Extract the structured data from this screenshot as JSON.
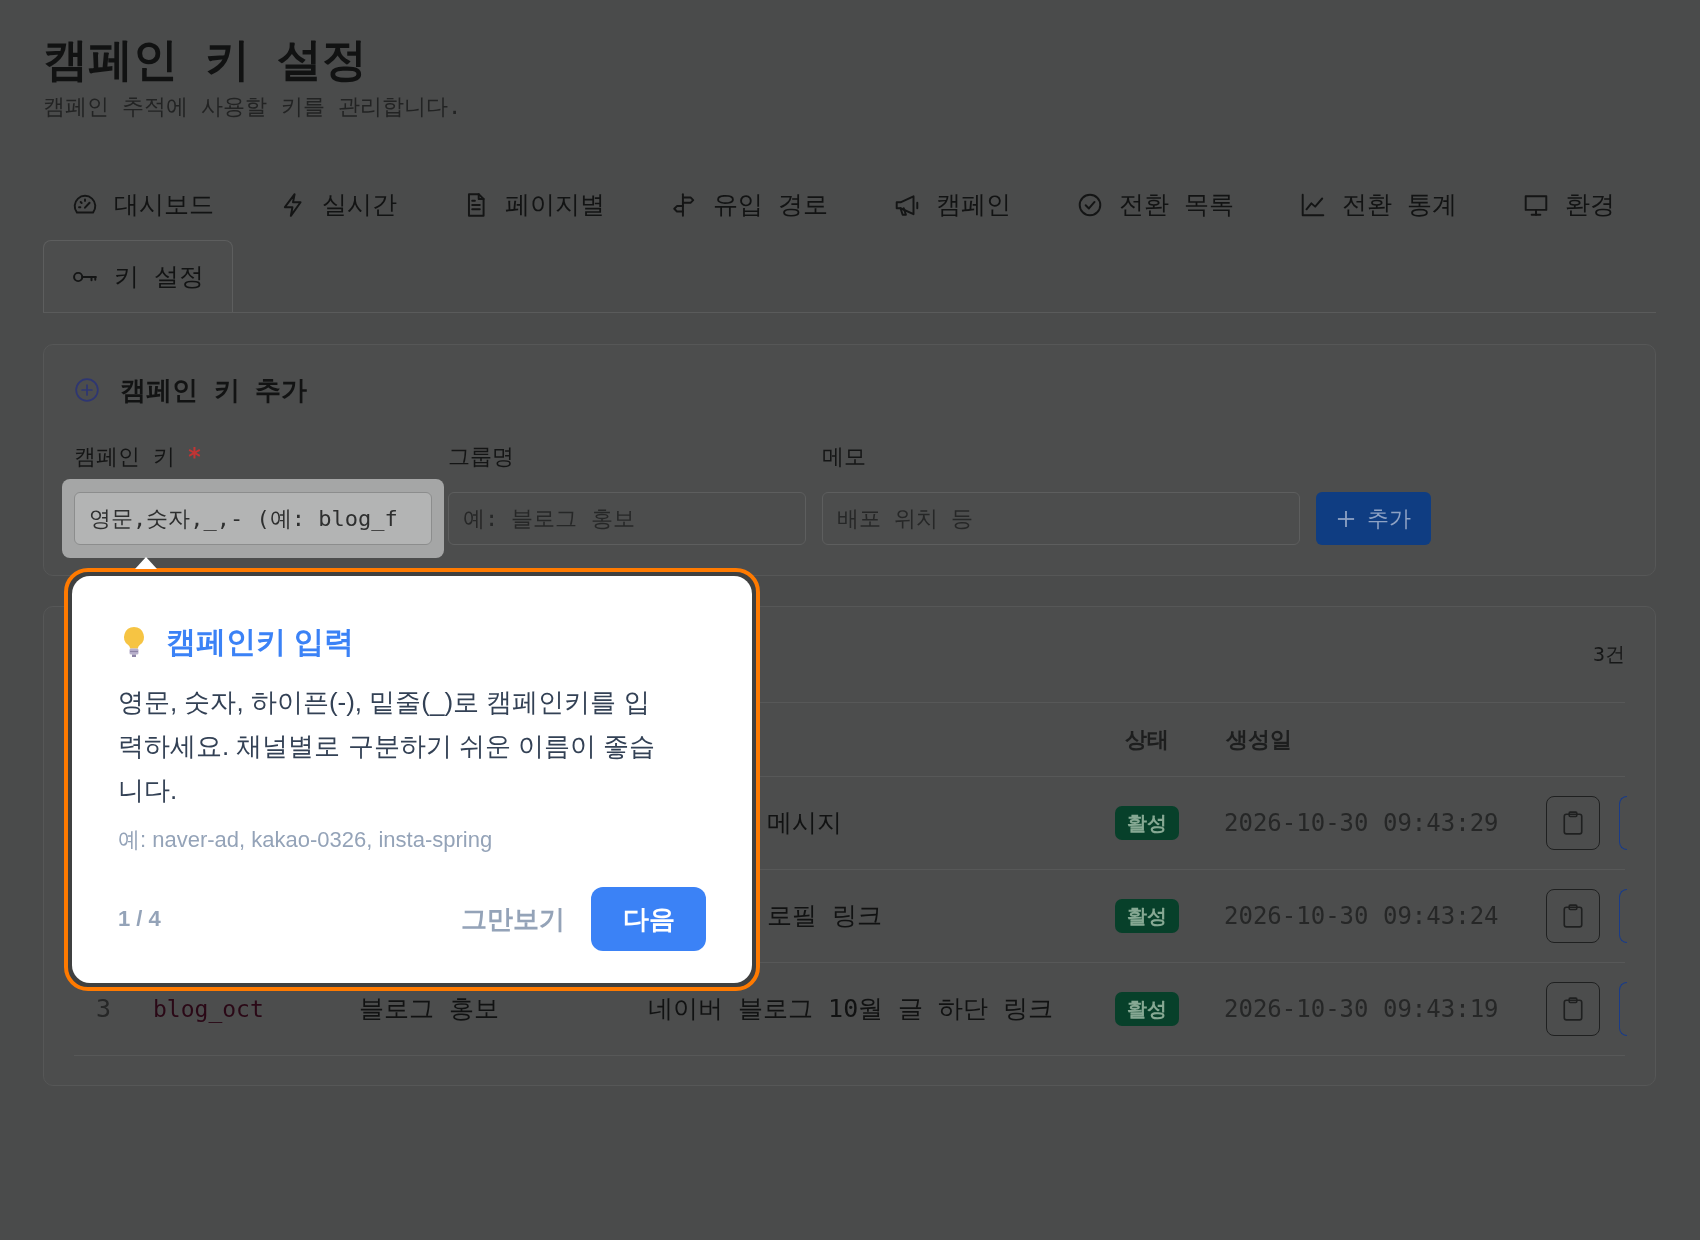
{
  "header": {
    "title": "캠페인 키 설정",
    "subtitle": "캠페인 추적에 사용할 키를 관리합니다."
  },
  "tabs": [
    {
      "label": "대시보드",
      "selected": false
    },
    {
      "label": "실시간",
      "selected": false
    },
    {
      "label": "페이지별",
      "selected": false
    },
    {
      "label": "유입 경로",
      "selected": false
    },
    {
      "label": "캠페인",
      "selected": false
    },
    {
      "label": "전환 목록",
      "selected": false
    },
    {
      "label": "전환 통계",
      "selected": false
    },
    {
      "label": "환경",
      "selected": false
    },
    {
      "label": "키 설정",
      "selected": true
    }
  ],
  "add_form": {
    "title": "캠페인 키 추가",
    "fields": [
      {
        "label": "캠페인 키",
        "required_mark": "*",
        "placeholder": "영문,숫자,_,- (예: blog_f",
        "highlighted": true
      },
      {
        "label": "그룹명",
        "placeholder": "예: 블로그 홍보",
        "highlighted": false
      },
      {
        "label": "메모",
        "placeholder": "배포 위치 등",
        "highlighted": false
      }
    ],
    "button": "추가"
  },
  "key_list": {
    "count": "3건",
    "columns": [
      "상태",
      "생성일"
    ],
    "rows": [
      {
        "memo": "메시지",
        "status": "활성",
        "created": "2026-10-30 09:43:29"
      },
      {
        "memo": "로필 링크",
        "status": "활성",
        "created": "2026-10-30 09:43:24"
      },
      {
        "number": "3",
        "key": "blog_oct",
        "group": "블로그 홍보",
        "memo": "네이버 블로그 10월 글 하단 링크",
        "status": "활성",
        "created": "2026-10-30 09:43:19"
      }
    ]
  },
  "tour": {
    "title": "캠페인키 입력",
    "body": "영문, 숫자, 하이픈(-), 밑줄(_)로 캠페인키를 입력하세요. 채널별로 구분하기 쉬운 이름이 좋습니다.",
    "example": "예: naver-ad, kakao-0326, insta-spring",
    "step": "1 / 4",
    "skip": "그만보기",
    "next": "다음"
  }
}
